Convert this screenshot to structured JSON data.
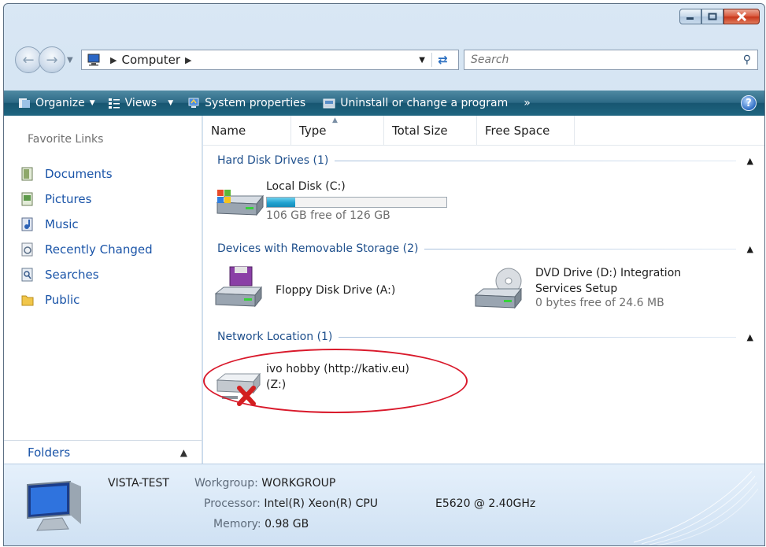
{
  "address_bar": {
    "breadcrumb": [
      "Computer"
    ],
    "search_placeholder": "Search"
  },
  "toolbar": {
    "organize": "Organize",
    "views": "Views",
    "system_properties": "System properties",
    "uninstall": "Uninstall or change a program",
    "more": "»",
    "help": "?"
  },
  "nav_pane": {
    "title": "Favorite Links",
    "links": [
      "Documents",
      "Pictures",
      "Music",
      "Recently Changed",
      "Searches",
      "Public"
    ],
    "folders_label": "Folders"
  },
  "columns": [
    "Name",
    "Type",
    "Total Size",
    "Free Space"
  ],
  "groups": {
    "hdd": {
      "title": "Hard Disk Drives (1)",
      "local_disk": {
        "name": "Local Disk (C:)",
        "free_text": "106 GB free of 126 GB",
        "used_fraction": 0.159
      }
    },
    "removable": {
      "title": "Devices with Removable Storage (2)",
      "floppy": {
        "name": "Floppy Disk Drive (A:)"
      },
      "dvd": {
        "name_line1": "DVD Drive (D:) Integration",
        "name_line2": "Services Setup",
        "free_text": "0 bytes free of 24.6 MB"
      }
    },
    "network": {
      "title": "Network Location (1)",
      "drive": {
        "name_line1": "ivo hobby (http://kativ.eu)",
        "name_line2": "(Z:)"
      }
    }
  },
  "details": {
    "computer_name": "VISTA-TEST",
    "workgroup_label": "Workgroup:",
    "workgroup": "WORKGROUP",
    "processor_label": "Processor:",
    "processor": "Intel(R) Xeon(R) CPU",
    "processor_model": "E5620  @ 2.40GHz",
    "memory_label": "Memory:",
    "memory": "0.98 GB"
  },
  "colors": {
    "toolbar": "#175571",
    "link": "#1a54a8",
    "group_header": "#1e4f8c",
    "highlight_circle": "#d9192b",
    "progress": "#21a2d0"
  }
}
